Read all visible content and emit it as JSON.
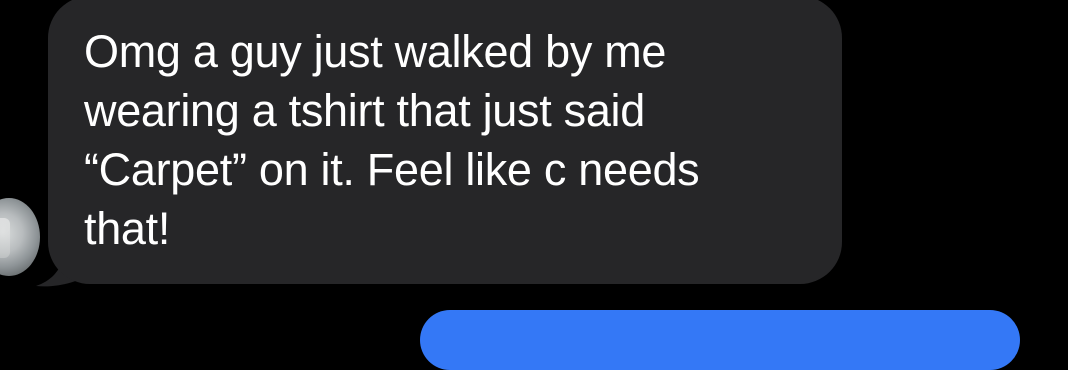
{
  "conversation": {
    "received_message": {
      "text": "Omg a guy just walked by me\nwearing a tshirt that just said\n“Carpet” on it. Feel like c needs\nthat!",
      "bubble_color": "#262628",
      "text_color": "#ffffff"
    },
    "sent_message": {
      "bubble_color": "#3478f6"
    },
    "background_color": "#000000"
  }
}
